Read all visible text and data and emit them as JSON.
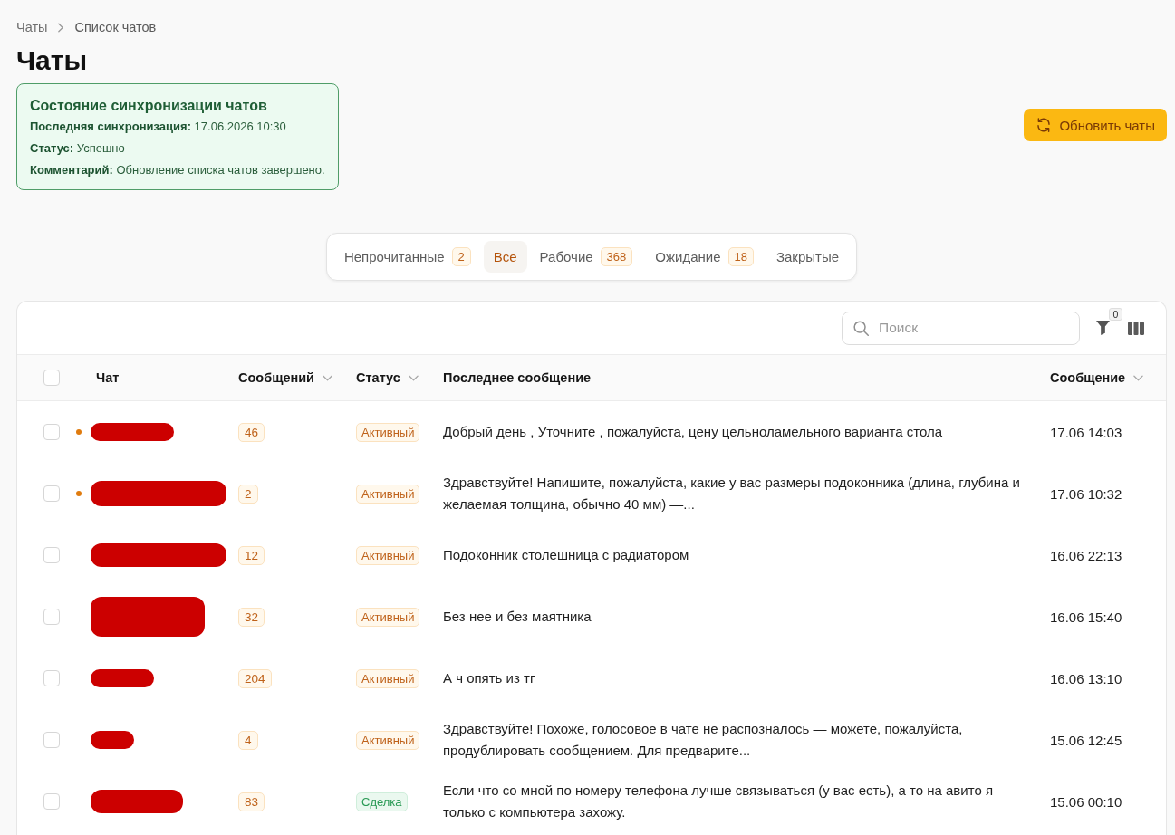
{
  "breadcrumb": [
    {
      "label": "Чаты"
    },
    {
      "label": "Список чатов"
    }
  ],
  "title": "Чаты",
  "sync_status": {
    "title": "Состояние синхронизации чатов",
    "fields": [
      {
        "label": "Последняя синхронизация:",
        "value": "17.06.2026 10:30"
      },
      {
        "label": "Статус:",
        "value": "Успешно"
      },
      {
        "label": "Комментарий:",
        "value": "Обновление списка чатов завершено."
      }
    ]
  },
  "refresh_button": {
    "label": "Обновить чаты"
  },
  "tabs": [
    {
      "label": "Непрочитанные",
      "count": "2",
      "selected": false
    },
    {
      "label": "Все",
      "selected": true
    },
    {
      "label": "Рабочие",
      "count": "368",
      "selected": false
    },
    {
      "label": "Ожидание",
      "count": "18",
      "selected": false
    },
    {
      "label": "Закрытые",
      "selected": false
    }
  ],
  "toolbar": {
    "search": {
      "placeholder": "Поиск"
    },
    "filter_count": "0"
  },
  "table": {
    "select_all": {
      "checked": false
    },
    "columns": [
      {
        "label": "Чат",
        "sortable": false
      },
      {
        "label": "Сообщений",
        "sortable": true
      },
      {
        "label": "Статус",
        "sortable": true
      },
      {
        "label": "Последнее сообщение",
        "sortable": false
      },
      {
        "label": "Сообщение",
        "sortable": true
      }
    ],
    "rows": [
      {
        "checked": false,
        "unread": true,
        "messages": "46",
        "status": {
          "label": "Активный",
          "kind": "active"
        },
        "last_message": "Добрый день , Уточните , пожалуйста, цену цельноламельного варианта стола",
        "time": "17.06 14:03"
      },
      {
        "checked": false,
        "unread": true,
        "messages": "2",
        "status": {
          "label": "Активный",
          "kind": "active"
        },
        "last_message": "Здравствуйте! Напишите, пожалуйста, какие у вас размеры подоконника (длина, глубина и желаемая толщина, обычно 40 мм) —...",
        "time": "17.06 10:32"
      },
      {
        "checked": false,
        "unread": false,
        "messages": "12",
        "status": {
          "label": "Активный",
          "kind": "active"
        },
        "last_message": "Подоконник столешница с радиатором",
        "time": "16.06 22:13"
      },
      {
        "checked": false,
        "unread": false,
        "messages": "32",
        "status": {
          "label": "Активный",
          "kind": "active"
        },
        "last_message": "Без нее и без маятника",
        "time": "16.06 15:40"
      },
      {
        "checked": false,
        "unread": false,
        "messages": "204",
        "status": {
          "label": "Активный",
          "kind": "active"
        },
        "last_message": "А ч опять из тг",
        "time": "16.06 13:10"
      },
      {
        "checked": false,
        "unread": false,
        "messages": "4",
        "status": {
          "label": "Активный",
          "kind": "active"
        },
        "last_message": "Здравствуйте! Похоже, голосовое в чате не распозналось — можете, пожалуйста, продублировать сообщением. Для предварите...",
        "time": "15.06 12:45"
      },
      {
        "checked": false,
        "unread": false,
        "messages": "83",
        "status": {
          "label": "Сделка",
          "kind": "deal"
        },
        "last_message": "Если что со мной по номеру телефона лучше связываться (у вас есть), а то на авито я только с компьютера захожу.",
        "time": "15.06 00:10"
      }
    ]
  }
}
